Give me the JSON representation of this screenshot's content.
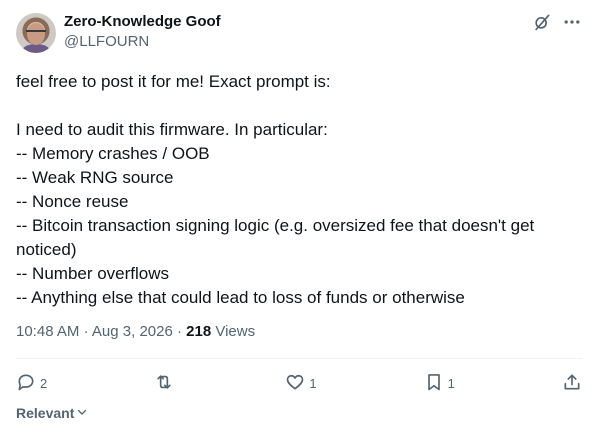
{
  "author": {
    "name": "Zero-Knowledge Goof",
    "handle": "@LLFOURN"
  },
  "tweet": {
    "text": "feel free to post it for me! Exact prompt is:\n\nI need to audit this firmware. In particular:\n-- Memory crashes / OOB\n-- Weak RNG source\n-- Nonce reuse\n-- Bitcoin transaction signing logic (e.g. oversized fee that doesn't get noticed)\n-- Number overflows\n-- Anything else that could lead to loss of funds or otherwise",
    "time": "10:48 AM",
    "sep1": "·",
    "date": "Aug 3, 2026",
    "sep2": "·",
    "views_count": "218",
    "views_label": "Views"
  },
  "actions": {
    "replies": "2",
    "retweets": "",
    "likes": "1",
    "bookmarks": "1"
  },
  "sort": {
    "label": "Relevant"
  },
  "icons": {
    "grok": "grok-icon",
    "more": "more-icon",
    "reply": "reply-icon",
    "retweet": "retweet-icon",
    "like": "like-icon",
    "bookmark": "bookmark-icon",
    "share": "share-icon",
    "chevron": "chevron-down-icon"
  }
}
